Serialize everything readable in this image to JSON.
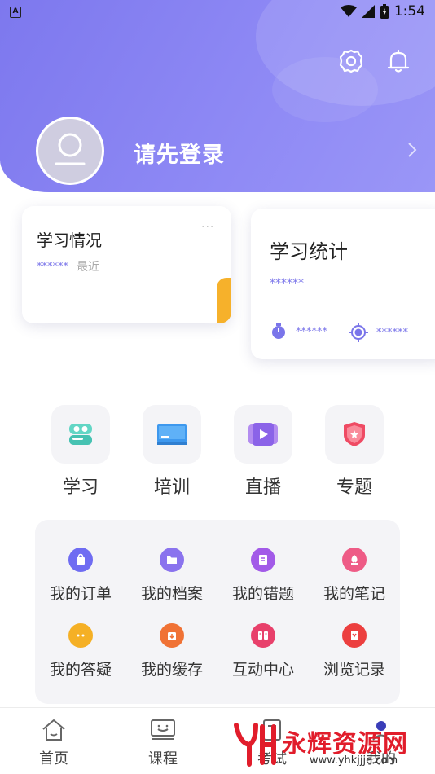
{
  "status_bar": {
    "app_badge": "A",
    "time": "1:54"
  },
  "header": {
    "login_prompt": "请先登录"
  },
  "study_card": {
    "title": "学习情况",
    "masked_value": "******",
    "recent_label": "最近",
    "more": "···"
  },
  "stats_card": {
    "title": "学习统计",
    "masked_total": "******",
    "masked_time": "******",
    "masked_points": "******"
  },
  "quick_entries": [
    {
      "label": "学习",
      "icon": "study-icon"
    },
    {
      "label": "培训",
      "icon": "training-icon"
    },
    {
      "label": "直播",
      "icon": "live-icon"
    },
    {
      "label": "专题",
      "icon": "topic-icon"
    }
  ],
  "my_grid": [
    {
      "label": "我的订单",
      "icon": "shopping-bag-icon",
      "color": "#6f6cf2"
    },
    {
      "label": "我的档案",
      "icon": "folder-icon",
      "color": "#8a73ee"
    },
    {
      "label": "我的错题",
      "icon": "error-book-icon",
      "color": "#a25ae8"
    },
    {
      "label": "我的笔记",
      "icon": "note-icon",
      "color": "#ee5b86"
    },
    {
      "label": "我的答疑",
      "icon": "chat-dots-icon",
      "color": "#f5b025"
    },
    {
      "label": "我的缓存",
      "icon": "download-box-icon",
      "color": "#f07235"
    },
    {
      "label": "互动中心",
      "icon": "interaction-icon",
      "color": "#e8406b"
    },
    {
      "label": "浏览记录",
      "icon": "history-icon",
      "color": "#ec3f3f"
    }
  ],
  "bottom_nav": [
    {
      "label": "首页",
      "icon": "home-icon"
    },
    {
      "label": "课程",
      "icon": "course-icon"
    },
    {
      "label": "考试",
      "icon": "exam-icon"
    },
    {
      "label": "我的",
      "icon": "profile-icon"
    }
  ],
  "watermark": {
    "text": "永辉资源网",
    "url": "www.yhkjjjc.com"
  },
  "colors": {
    "accent": "#7d78ee",
    "card_tab": "#f6b12b"
  }
}
